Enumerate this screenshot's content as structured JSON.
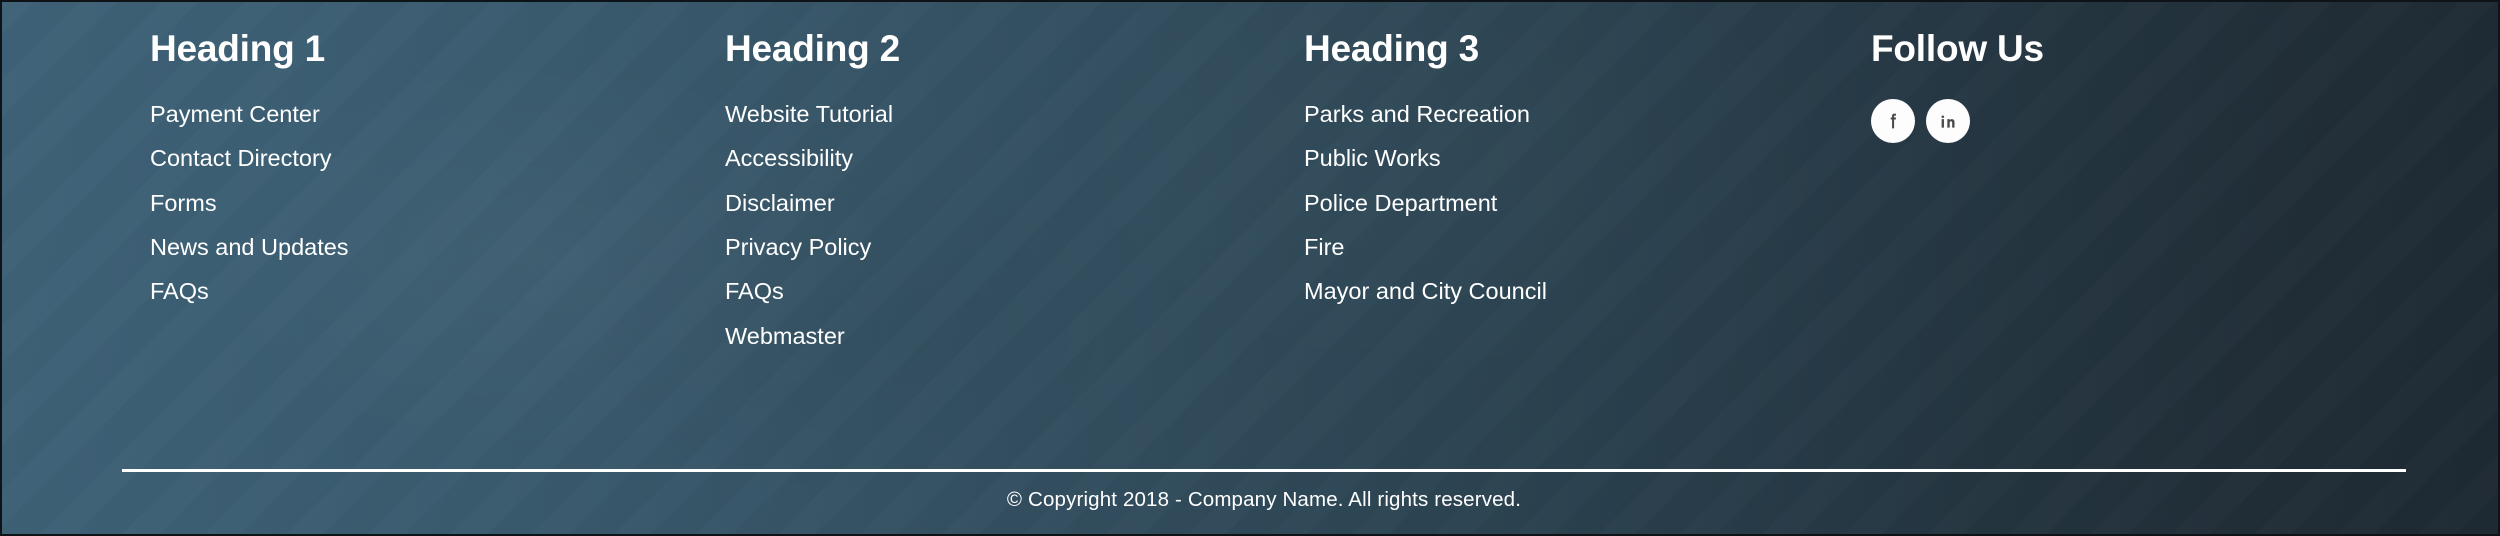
{
  "footer": {
    "background": {
      "gradient_start": "#3f6278",
      "gradient_end": "#1e2a33",
      "text_color": "#ffffff",
      "divider_color": "#ffffff"
    },
    "columns": [
      {
        "heading": "Heading 1",
        "links": [
          "Payment Center",
          "Contact Directory",
          "Forms",
          "News and Updates",
          "FAQs"
        ]
      },
      {
        "heading": "Heading 2",
        "links": [
          "Website Tutorial",
          "Accessibility",
          "Disclaimer",
          "Privacy Policy",
          "FAQs",
          "Webmaster"
        ]
      },
      {
        "heading": "Heading 3",
        "links": [
          "Parks and Recreation",
          "Public Works",
          "Police Department",
          "Fire",
          "Mayor and City Council"
        ]
      }
    ],
    "social": {
      "heading": "Follow Us",
      "icon_color": "#4a4a4a",
      "icon_background": "#fdfdfd",
      "items": [
        {
          "name": "facebook-icon",
          "label": "f"
        },
        {
          "name": "linkedin-icon",
          "label": "in"
        }
      ]
    },
    "copyright": "© Copyright 2018 - Company Name. All rights reserved."
  }
}
